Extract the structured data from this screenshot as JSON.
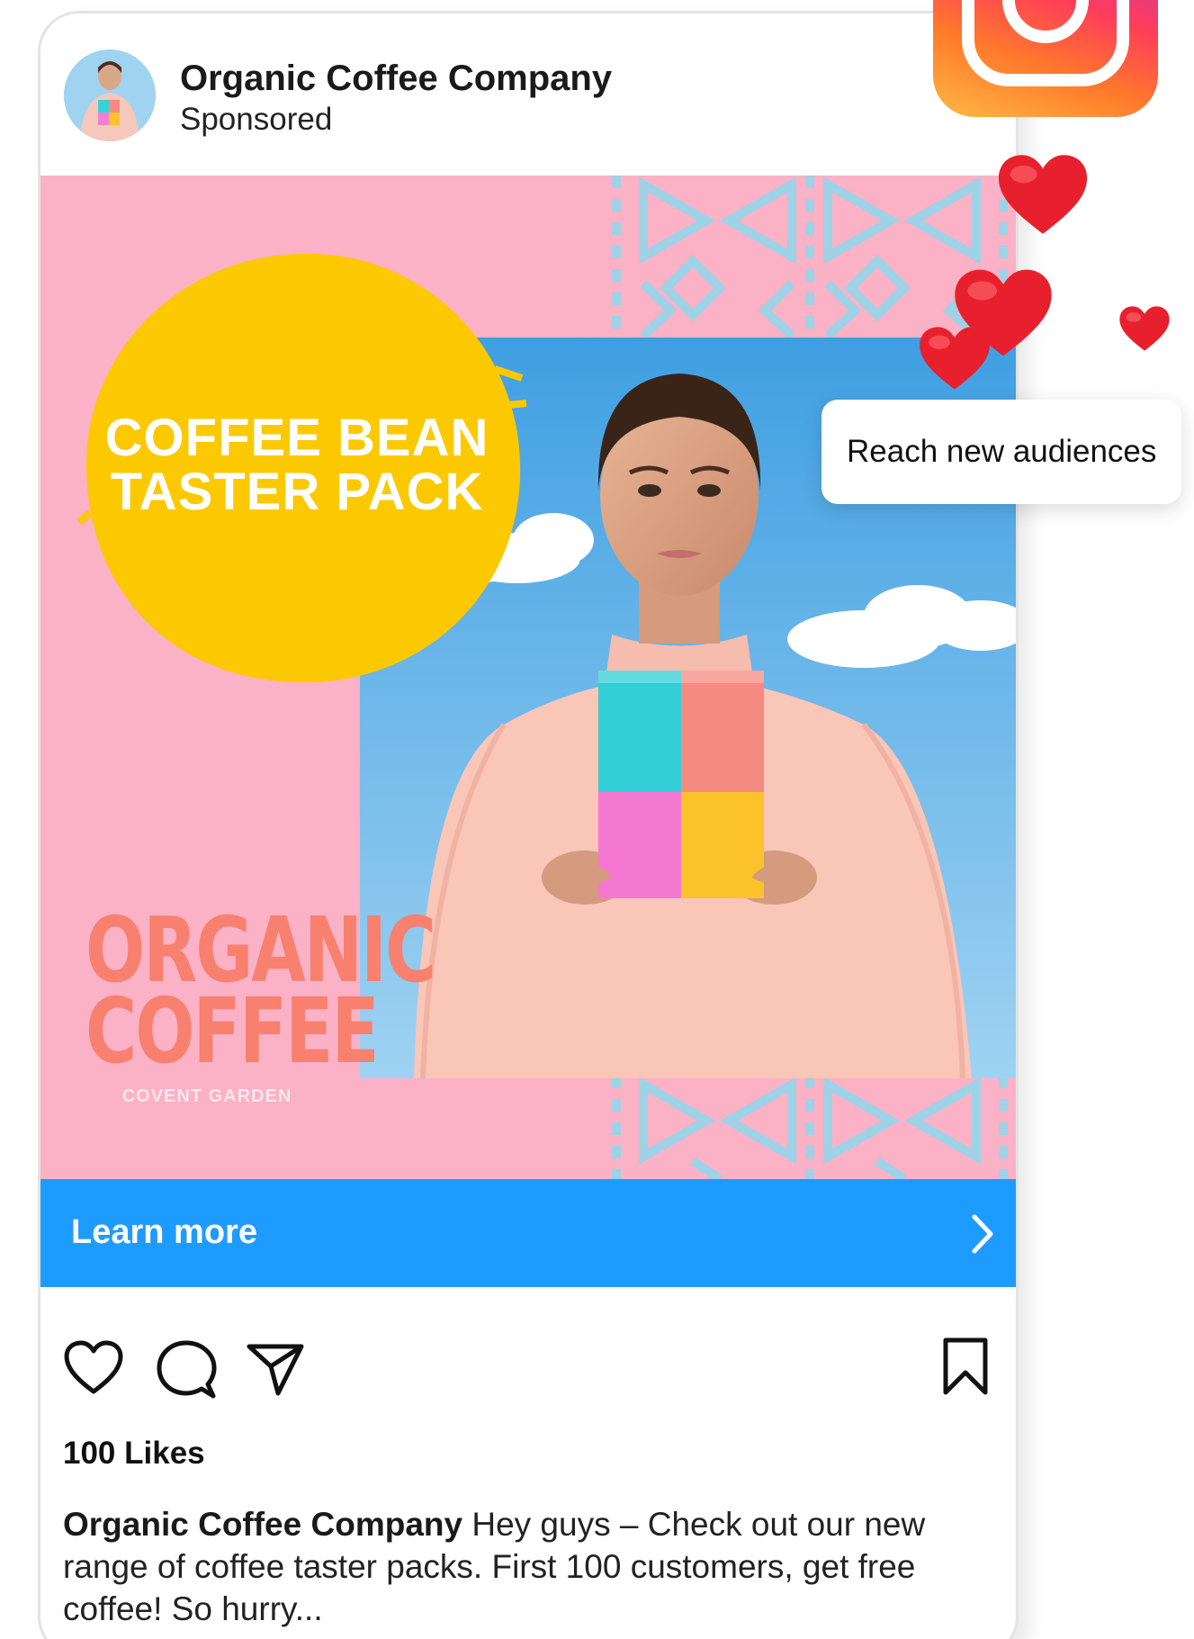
{
  "post": {
    "author": "Organic Coffee Company",
    "subtitle": "Sponsored",
    "avatar_icon": "profile-photo",
    "likes": "100 Likes",
    "caption_author": "Organic Coffee Company",
    "caption_text": " Hey guys – Check out our new range of coffee taster packs. First 100 customers, get free coffee! So hurry..."
  },
  "creative": {
    "headline_line1": "COFFEE BEAN",
    "headline_line2": "TASTER PACK",
    "logo_word1": "ORGANIC",
    "logo_word2": "COFFEE",
    "logo_subtitle": "COVENT GARDEN",
    "colors": {
      "background": "#fbb1c6",
      "circle": "#fcc900",
      "pattern": "#9ed2e6",
      "logo": "#f8806e",
      "sky": "#56ace6"
    }
  },
  "cta": {
    "label": "Learn more",
    "color": "#1e9bff",
    "icon": "chevron-right-icon"
  },
  "actions": {
    "icons": [
      "heart-icon",
      "comment-icon",
      "share-icon",
      "bookmark-icon"
    ]
  },
  "decor": {
    "app_logo": "instagram-icon",
    "bubble_text": "Reach new audiences",
    "heart_color": "#e8202d"
  }
}
